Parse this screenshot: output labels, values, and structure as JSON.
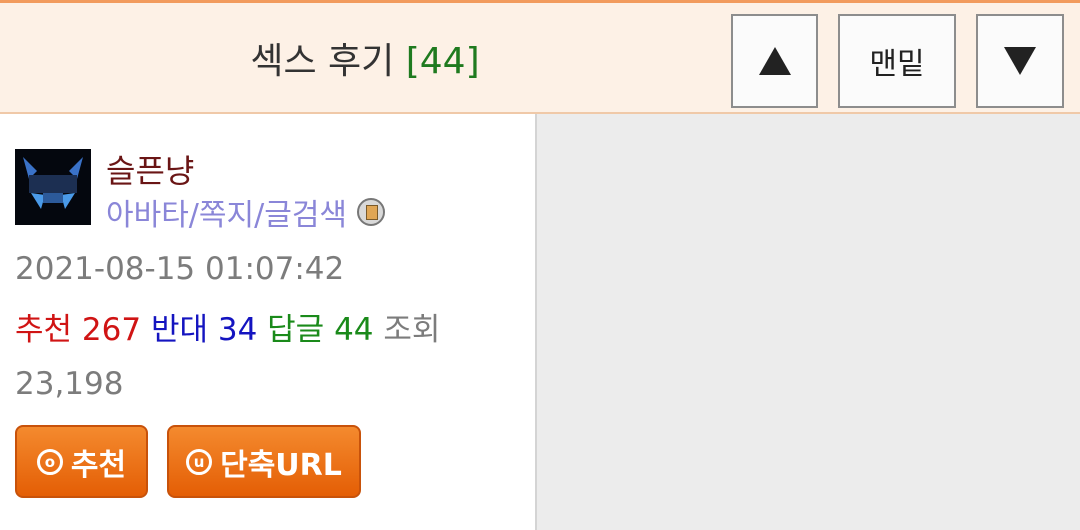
{
  "header": {
    "title": "섹스 후기",
    "reply_count": "[44]",
    "up_icon": "triangle-up-icon",
    "bottom_label": "맨밑",
    "down_icon": "triangle-down-icon"
  },
  "post": {
    "username": "슬픈냥",
    "user_links": "아바타/쪽지/글검색",
    "message_icon": "envelope-icon",
    "datetime": "2021-08-15 01:07:42",
    "stats": {
      "recommend_label": "추천",
      "recommend_value": "267",
      "oppose_label": "반대",
      "oppose_value": "34",
      "reply_label": "답글",
      "reply_value": "44",
      "views_label": "조회",
      "views_value": "23,198"
    },
    "recommend_button": {
      "icon_glyph": "o",
      "label": "추천"
    },
    "short_url_button": {
      "icon_glyph": "u",
      "label": "단축URL"
    }
  },
  "colors": {
    "header_bg": "#fdf1e6",
    "accent_orange": "#e8650a",
    "recommend": "#d01414",
    "oppose": "#1414c0",
    "reply": "#1a8a1a"
  }
}
